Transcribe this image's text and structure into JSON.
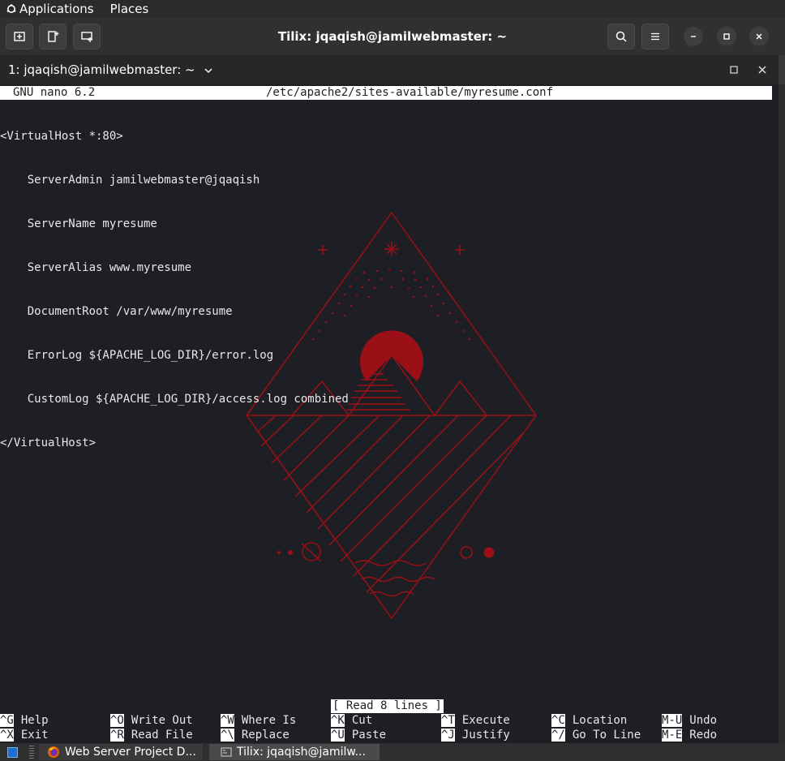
{
  "topbar": {
    "applications": "Applications",
    "places": "Places"
  },
  "window": {
    "title": "Tilix: jqaqish@jamilwebmaster: ~"
  },
  "session": {
    "label": "1: jqaqish@jamilwebmaster: ~"
  },
  "nano": {
    "title": "GNU nano 6.2",
    "filename": "/etc/apache2/sites-available/myresume.conf",
    "lines": [
      "<VirtualHost *:80>",
      "    ServerAdmin jamilwebmaster@jqaqish",
      "    ServerName myresume",
      "    ServerAlias www.myresume",
      "    DocumentRoot /var/www/myresume",
      "    ErrorLog ${APACHE_LOG_DIR}/error.log",
      "    CustomLog ${APACHE_LOG_DIR}/access.log combined",
      "</VirtualHost>"
    ],
    "status": "[ Read 8 lines ]",
    "shortcuts": [
      {
        "key": "^G",
        "label": "Help"
      },
      {
        "key": "^O",
        "label": "Write Out"
      },
      {
        "key": "^W",
        "label": "Where Is"
      },
      {
        "key": "^K",
        "label": "Cut"
      },
      {
        "key": "^T",
        "label": "Execute"
      },
      {
        "key": "^C",
        "label": "Location"
      },
      {
        "key": "M-U",
        "label": "Undo"
      },
      {
        "key": "^X",
        "label": "Exit"
      },
      {
        "key": "^R",
        "label": "Read File"
      },
      {
        "key": "^\\",
        "label": "Replace"
      },
      {
        "key": "^U",
        "label": "Paste"
      },
      {
        "key": "^J",
        "label": "Justify"
      },
      {
        "key": "^/",
        "label": "Go To Line"
      },
      {
        "key": "M-E",
        "label": "Redo"
      }
    ]
  },
  "taskbar": {
    "tasks": [
      {
        "label": "Web Server Project D...",
        "icon": "firefox-icon"
      },
      {
        "label": "Tilix: jqaqish@jamilw...",
        "icon": "terminal-icon"
      }
    ]
  },
  "colors": {
    "wallpaper_accent": "#9b1016",
    "terminal_bg": "#1e1f24"
  }
}
